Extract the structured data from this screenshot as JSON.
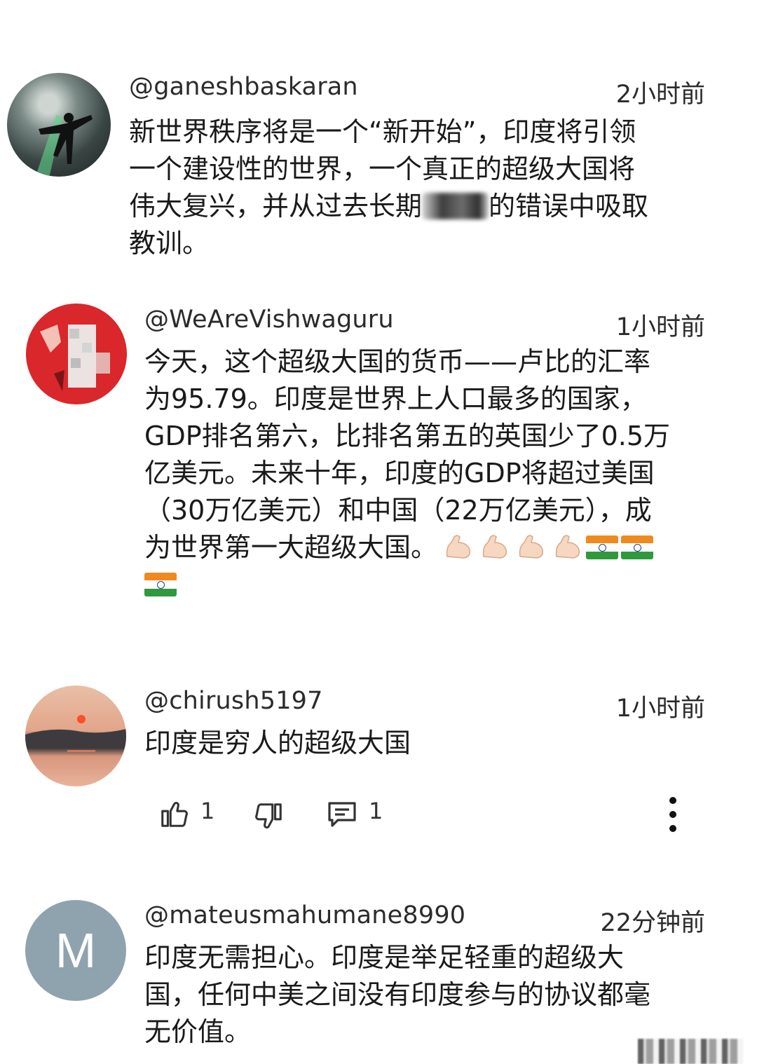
{
  "comments": [
    {
      "username": "@ganeshbaskaran",
      "time": "2小时前",
      "lines": [
        "新世界秩序将是一个“新开始”，印度将引领",
        "一个建设性的世界，一个真正的超级大国将",
        "伟大复兴，并从过去长期",
        "的错误中吸取",
        "教训。"
      ],
      "avatar": "photo-avatar"
    },
    {
      "username": "@WeAreVishwaguru",
      "time": "1小时前",
      "lines": [
        "今天，这个超级大国的货币——卢比的汇率",
        "为95.79。印度是世界上人口最多的国家，",
        "GDP排名第六，比排名第五的英国少了0.5万",
        "亿美元。未来十年，印度的GDP将超过美国",
        "（30万亿美元）和中国（22万亿美元），成",
        "为世界第一大超级大国。"
      ],
      "avatar": "red-avatar"
    },
    {
      "username": "@chirush5197",
      "time": "1小时前",
      "lines": [
        "印度是穷人的超级大国"
      ],
      "avatar": "sunset-avatar",
      "likes": "1",
      "replies": "1"
    },
    {
      "username": "@mateusmahumane8990",
      "time": "22分钟前",
      "lines": [
        "印度无需担心。印度是举足轻重的超级大",
        "国，任何中美之间没有印度参与的协议都毫",
        "无价值。"
      ],
      "avatar_letter": "M"
    }
  ],
  "colors": {
    "accent_gray_avatar": "#8fa3ae",
    "flag_saffron": "#f08a1f",
    "flag_green": "#2e9a3b"
  },
  "icons": [
    "thumbs-up-icon",
    "thumbs-down-icon",
    "reply-icon",
    "more-vert-icon",
    "flexed-biceps-icon",
    "india-flag-icon"
  ]
}
